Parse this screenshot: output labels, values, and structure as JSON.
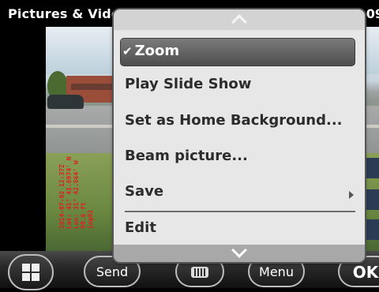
{
  "status_bar": {
    "app_title": "Pictures & Videos",
    "time": "09"
  },
  "photo": {
    "stamp_lines": [
      "2014-07-02 12:37Z",
      "Lat: 41° 41.6974' N",
      "Lon: 31° 42.864' W",
      "50.6 ft",
      "img02"
    ]
  },
  "menu": {
    "items": [
      {
        "label": "Zoom",
        "checked": "✔"
      },
      {
        "label": "Play Slide Show"
      },
      {
        "label": "Set as Home Background..."
      },
      {
        "label": "Beam picture..."
      },
      {
        "label": "Save"
      },
      {
        "label": "Edit"
      }
    ]
  },
  "softkeys": {
    "left": "Send",
    "right": "Menu",
    "ok": "OK"
  },
  "colors": {
    "menu_bg": "#e7e7e7",
    "selected_bg": "#5e5e5e",
    "stamp": "#e02020"
  }
}
